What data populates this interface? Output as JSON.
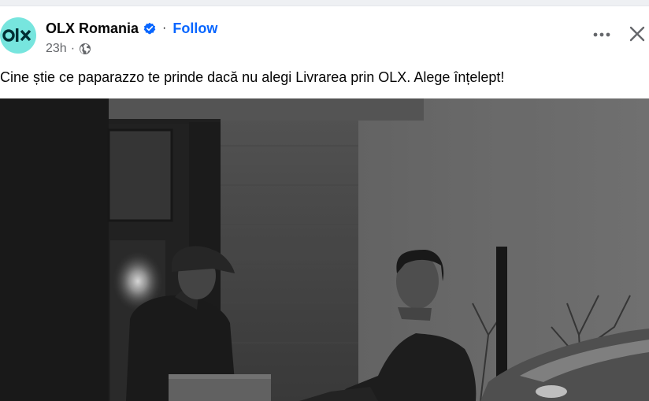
{
  "page": {
    "name": "OLX Romania",
    "follow_label": "Follow",
    "separator": "·",
    "timestamp": "23h",
    "audience_icon": "globe-icon",
    "verified_icon": "verified-badge-icon",
    "logo_text": "OLX"
  },
  "post": {
    "caption": "Cine știe ce paparazzo te prinde dacă nu alegi Livrarea prin OLX. Alege înțelept!",
    "image_icon": "post-photo"
  },
  "actions": {
    "more_icon": "more-options-icon",
    "close_icon": "close-icon"
  },
  "colors": {
    "brand": "#77e5de",
    "link": "#0866ff",
    "text": "#050505",
    "muted": "#65676b"
  }
}
